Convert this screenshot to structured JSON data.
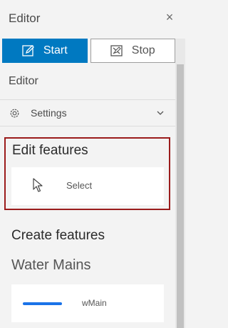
{
  "header": {
    "title": "Editor",
    "close_icon": "close-icon"
  },
  "toggle": {
    "start_label": "Start",
    "stop_label": "Stop",
    "active": "start",
    "accent": "#0079c1"
  },
  "section": {
    "title": "Editor"
  },
  "settings": {
    "label": "Settings"
  },
  "edit_features": {
    "title": "Edit features",
    "select_label": "Select",
    "highlight_color": "#9b1c1c"
  },
  "create_features": {
    "title": "Create features",
    "layer_title": "Water Mains",
    "templates": [
      {
        "label": "wMain",
        "symbol_color": "#1a73e8"
      }
    ]
  }
}
